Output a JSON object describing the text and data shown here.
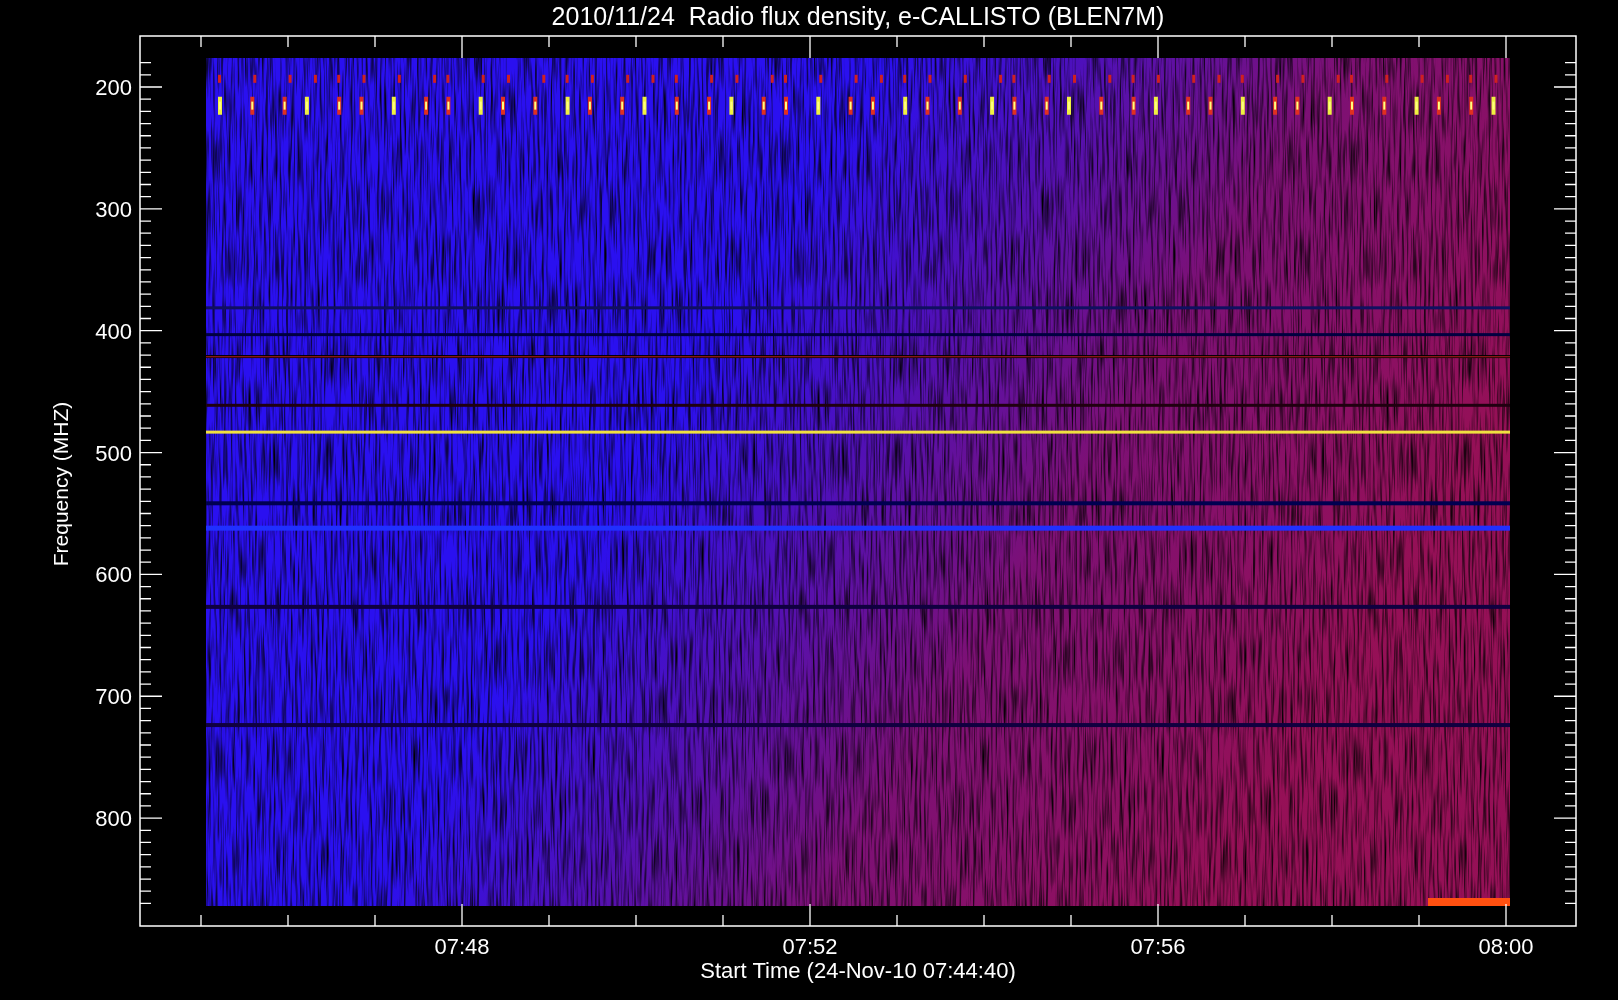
{
  "chart": {
    "title": "2010/11/24  Radio flux density, e-CALLISTO (BLEN7M)",
    "y_axis": {
      "label": "Frequency (MHZ)",
      "ticks": [
        "200",
        "300",
        "400",
        "500",
        "600",
        "700",
        "800"
      ]
    },
    "x_axis": {
      "label": "Start Time (24-Nov-10 07:44:40)",
      "ticks": [
        "07:48",
        "07:52",
        "07:56",
        "08:00"
      ]
    }
  }
}
